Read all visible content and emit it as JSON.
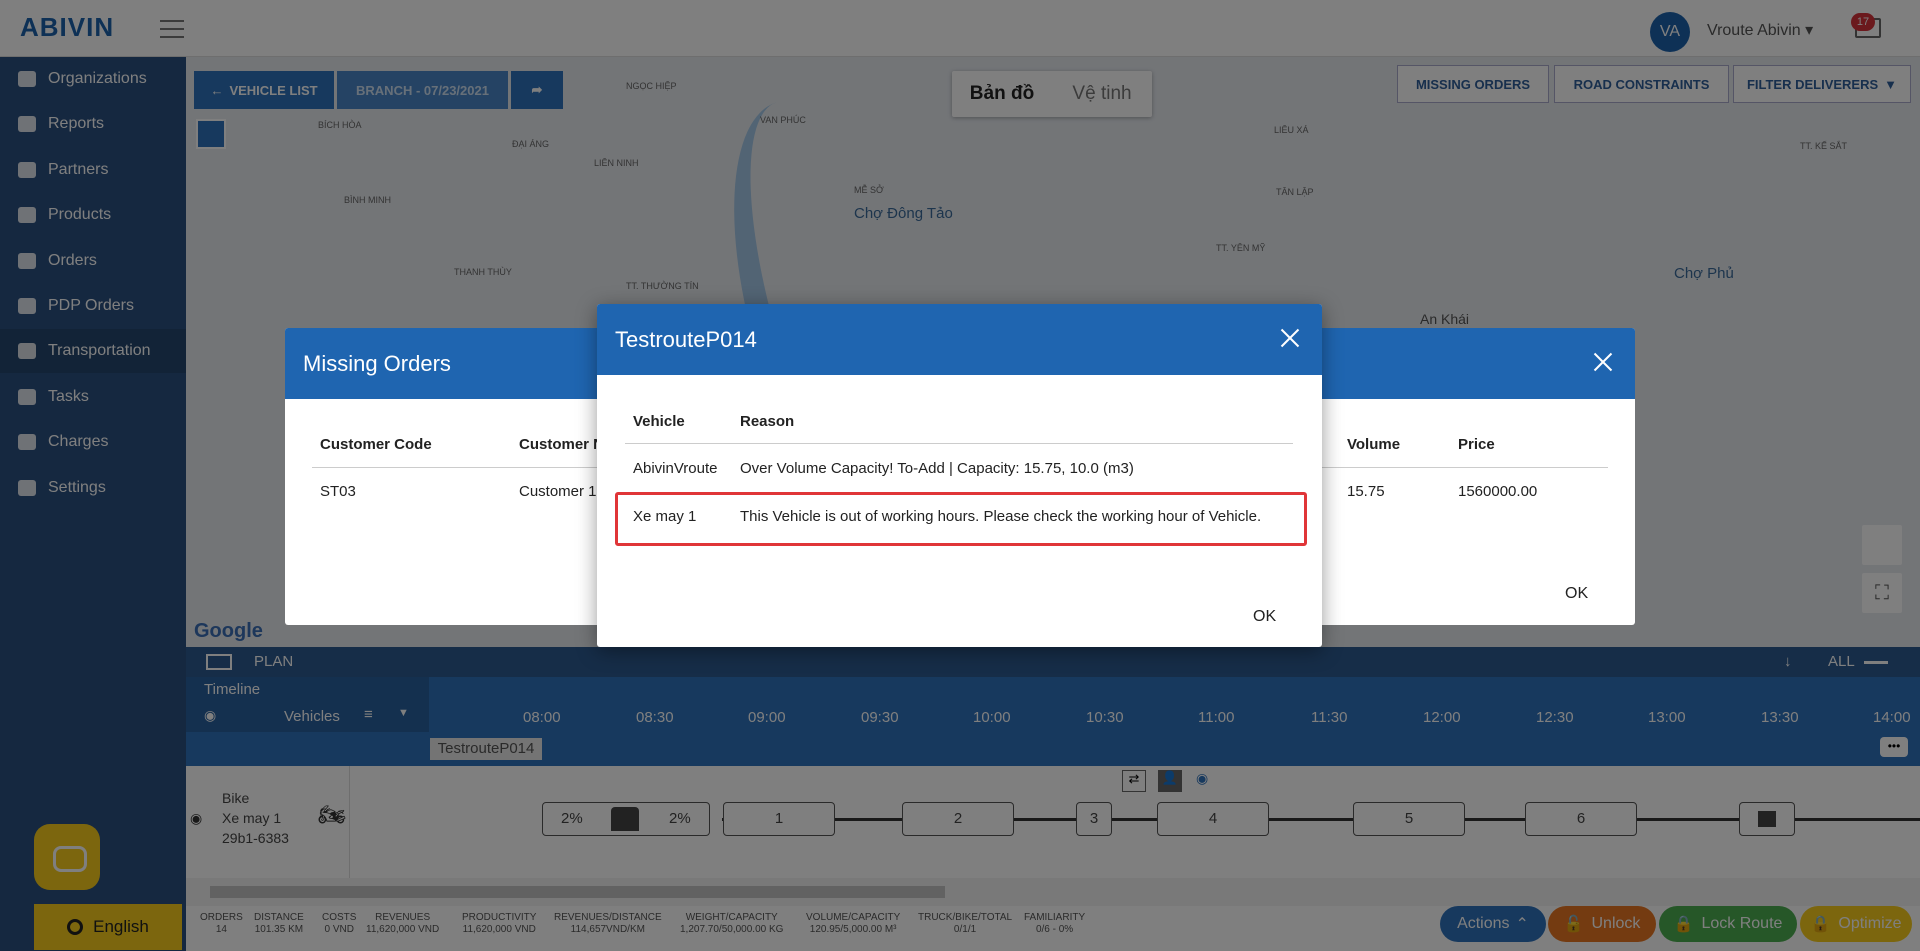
{
  "topbar": {
    "logo": "ABIVIN",
    "avatar_initials": "VA",
    "username": "Vroute Abivin",
    "mail_count": "17"
  },
  "sidebar": {
    "items": [
      {
        "label": "Organizations",
        "icon": "home-icon"
      },
      {
        "label": "Reports",
        "icon": "chart-icon"
      },
      {
        "label": "Partners",
        "icon": "users-icon"
      },
      {
        "label": "Products",
        "icon": "boxes-icon"
      },
      {
        "label": "Orders",
        "icon": "orders-icon"
      },
      {
        "label": "PDP Orders",
        "icon": "list-icon"
      },
      {
        "label": "Transportation",
        "icon": "road-icon"
      },
      {
        "label": "Tasks",
        "icon": "calendar-icon"
      },
      {
        "label": "Charges",
        "icon": "money-icon"
      },
      {
        "label": "Settings",
        "icon": "gear-icon"
      }
    ],
    "language": "English"
  },
  "map": {
    "vehicle_list": "VEHICLE LIST",
    "branch": "BRANCH - 07/23/2021",
    "map_type": [
      "Bản đồ",
      "Vệ tinh"
    ],
    "missing_orders": "MISSING ORDERS",
    "road_constraints": "ROAD CONSTRAINTS",
    "filter_deliverers": "FILTER DELIVERERS",
    "labels": [
      "NGỌC HIỆP",
      "VAN PHÚC",
      "BÍCH HÒA",
      "ĐẠI ÁNG",
      "LIÊN NINH",
      "BÌNH MINH",
      "THANH THÙY",
      "Chợ Đông Tảo",
      "Chợ Phủ",
      "An Khái",
      "TÂN LẬP",
      "LIÊU XÁ",
      "TT. KẾ SẮT",
      "TT. THƯỜNG TÍN",
      "MỄ SỞ",
      "TT. YÊN MỸ"
    ],
    "google": "Google"
  },
  "plan": {
    "title": "PLAN",
    "all": "ALL",
    "timeline": "Timeline",
    "vehicles": "Vehicles",
    "hours": [
      "08:00",
      "08:30",
      "09:00",
      "09:30",
      "10:00",
      "10:30",
      "11:00",
      "11:30",
      "12:00",
      "12:30",
      "13:00",
      "13:30",
      "14:00"
    ],
    "route_name": "TestrouteP014",
    "vehicle_type": "Bike",
    "vehicle_name": "Xe may 1",
    "vehicle_plate": "29b1-6383",
    "stops": [
      "2%",
      "2%",
      "1",
      "2",
      "3",
      "4",
      "5",
      "6"
    ]
  },
  "stats": [
    {
      "label": "ORDERS",
      "value": "14"
    },
    {
      "label": "DISTANCE",
      "value": "101.35 KM"
    },
    {
      "label": "COSTS",
      "value": "0 VND"
    },
    {
      "label": "REVENUES",
      "value": "11,620,000 VND"
    },
    {
      "label": "PRODUCTIVITY",
      "value": "11,620,000 VND"
    },
    {
      "label": "REVENUES/DISTANCE",
      "value": "114,657VND/KM"
    },
    {
      "label": "WEIGHT/CAPACITY",
      "value": "1,207.70/50,000.00 KG"
    },
    {
      "label": "VOLUME/CAPACITY",
      "value": "120.95/5,000.00 M³"
    },
    {
      "label": "TRUCK/BIKE/TOTAL",
      "value": "0/1/1"
    },
    {
      "label": "FAMILIARITY",
      "value": "0/6 - 0%"
    }
  ],
  "actions": {
    "actions": "Actions",
    "unlock": "Unlock",
    "lock_route": "Lock Route",
    "optimize": "Optimize"
  },
  "missing_dialog": {
    "title": "Missing Orders",
    "headers": [
      "Customer Code",
      "Customer N",
      "Volume",
      "Price"
    ],
    "row": {
      "code": "ST03",
      "customer": "Customer 1",
      "volume": "15.75",
      "price": "1560000.00"
    },
    "ok": "OK"
  },
  "route_dialog": {
    "title": "TestrouteP014",
    "headers": [
      "Vehicle",
      "Reason"
    ],
    "rows": [
      {
        "vehicle": "AbivinVroute",
        "reason": "Over Volume Capacity! To-Add | Capacity: 15.75, 10.0 (m3)"
      },
      {
        "vehicle": "Xe may 1",
        "reason": "This Vehicle is out of working hours. Please check the working hour of Vehicle."
      }
    ],
    "ok": "OK"
  },
  "colors": {
    "sidebar": "#2b5180",
    "primary": "#1f65b0",
    "accent": "#f8cd1c",
    "highlight": "#e03538"
  }
}
